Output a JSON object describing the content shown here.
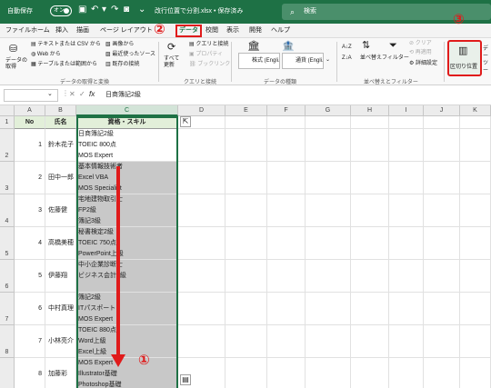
{
  "titlebar": {
    "autosave_label": "自動保存",
    "autosave_state": "オン",
    "filename": "改行位置で分割.xlsx • 保存済み",
    "search_placeholder": "検索"
  },
  "menu": {
    "tabs": [
      "ファイル",
      "ホーム",
      "挿入",
      "描画",
      "ページ レイアウト",
      "データ",
      "校閲",
      "表示",
      "開発",
      "ヘルプ"
    ],
    "active_tab": "データ"
  },
  "ribbon": {
    "get_data_label": "データの取得",
    "text_csv": "テキストまたは CSV から",
    "web": "Web から",
    "table_range": "テーブルまたは範囲から",
    "from_image": "画像から",
    "recent_sources": "最近使ったソース",
    "existing_connections": "既存の接続",
    "group_get_transform": "データの取得と変換",
    "refresh_all": "すべて 更新",
    "queries_connections": "クエリと接続",
    "properties": "プロパティ",
    "workbook_links": "ブックリンク",
    "group_queries": "クエリと接続",
    "stocks": "株式 (Engli...",
    "currency": "通貨 (Engli...",
    "group_data_types": "データの種類",
    "sort": "並べ替え",
    "filter": "フィルター",
    "clear": "クリア",
    "reapply": "再適用",
    "advanced": "詳細設定",
    "group_sort_filter": "並べ替えとフィルター",
    "text_to_columns": "区切り位置",
    "data_tools_partial": "デー ツー"
  },
  "annotations": {
    "step1": "①",
    "step2": "②",
    "step3": "③"
  },
  "formula_bar": {
    "fx": "fx",
    "content": "日商簿記2級"
  },
  "columns": [
    "A",
    "B",
    "C",
    "D",
    "E",
    "F",
    "G",
    "H",
    "I",
    "J",
    "K"
  ],
  "rows_headers": [
    "1",
    "2",
    "3",
    "4",
    "5",
    "6",
    "7",
    "8"
  ],
  "table": {
    "headers": [
      "No",
      "氏名",
      "資格・スキル"
    ],
    "rows": [
      {
        "no": "1",
        "name": "鈴木花子",
        "skills": [
          "日商簿記2級",
          "TOEIC 800点",
          "MOS Expert"
        ]
      },
      {
        "no": "2",
        "name": "田中一郎",
        "skills": [
          "基本情報技術者",
          "Excel VBA",
          "MOS Specialist"
        ]
      },
      {
        "no": "3",
        "name": "佐藤健",
        "skills": [
          "宅地建物取引士",
          "FP2級",
          "簿記3級"
        ]
      },
      {
        "no": "4",
        "name": "高橋美穂",
        "skills": [
          "秘書検定2級",
          "TOEIC 750点",
          "PowerPoint上級"
        ]
      },
      {
        "no": "5",
        "name": "伊藤翔",
        "skills": [
          "中小企業診断士",
          "ビジネス会計2級"
        ]
      },
      {
        "no": "6",
        "name": "中村真理",
        "skills": [
          "簿記2級",
          "ITパスポート",
          "MOS Expert"
        ]
      },
      {
        "no": "7",
        "name": "小林亮介",
        "skills": [
          "TOEIC 880点",
          "Word上級",
          "Excel上級"
        ]
      },
      {
        "no": "8",
        "name": "加藤彩",
        "skills": [
          "MOS Expert",
          "Illustrator基礎",
          "Photoshop基礎"
        ]
      }
    ]
  },
  "colors": {
    "accent": "#1e7145",
    "annotation": "#e01b1b",
    "selection_fill": "#c8c8c8",
    "header_fill": "#e2efd9"
  }
}
